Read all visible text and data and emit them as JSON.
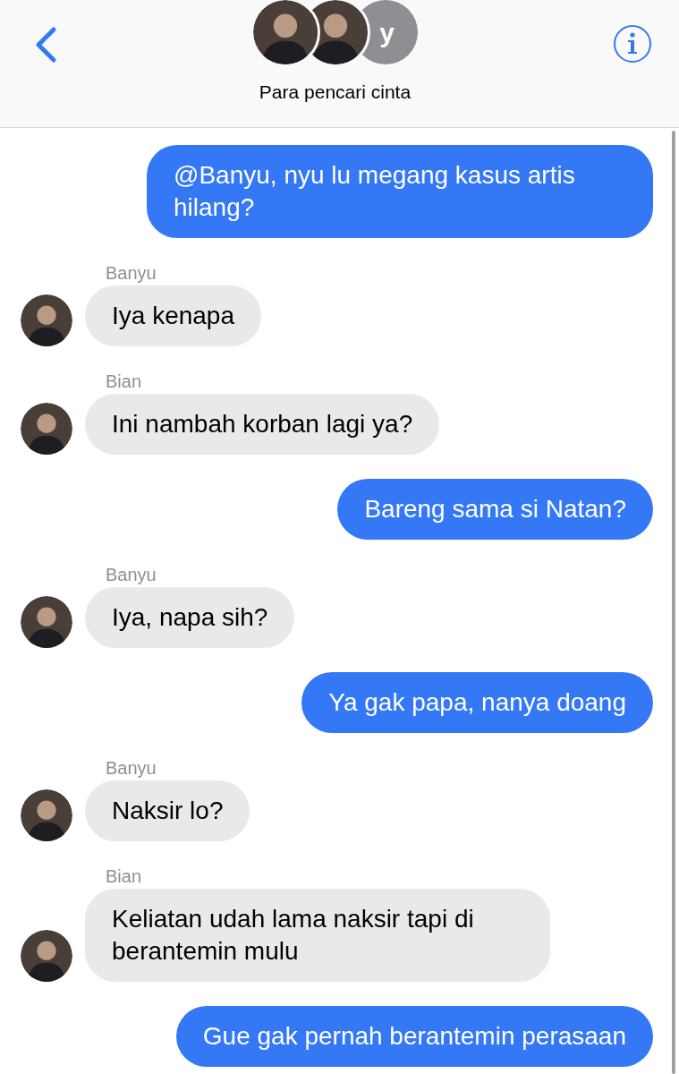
{
  "header": {
    "avatars": [
      {
        "kind": "photo"
      },
      {
        "kind": "photo"
      },
      {
        "kind": "letter",
        "letter": "y"
      }
    ],
    "title": "Para pencari cinta"
  },
  "messages": [
    {
      "kind": "outgoing",
      "text": "@Banyu, nyu lu megang kasus artis hilang?"
    },
    {
      "kind": "incoming",
      "sender": "Banyu",
      "text": "Iya kenapa"
    },
    {
      "kind": "incoming",
      "sender": "Bian",
      "text": "Ini nambah korban lagi ya?"
    },
    {
      "kind": "outgoing",
      "text": "Bareng sama si Natan?"
    },
    {
      "kind": "incoming",
      "sender": "Banyu",
      "text": "Iya, napa sih?"
    },
    {
      "kind": "outgoing",
      "text": "Ya gak papa, nanya doang"
    },
    {
      "kind": "incoming",
      "sender": "Banyu",
      "text": "Naksir lo?"
    },
    {
      "kind": "incoming",
      "sender": "Bian",
      "text": "Keliatan udah lama naksir tapi di berantemin mulu"
    },
    {
      "kind": "outgoing",
      "text": "Gue gak pernah berantemin perasaan"
    }
  ]
}
